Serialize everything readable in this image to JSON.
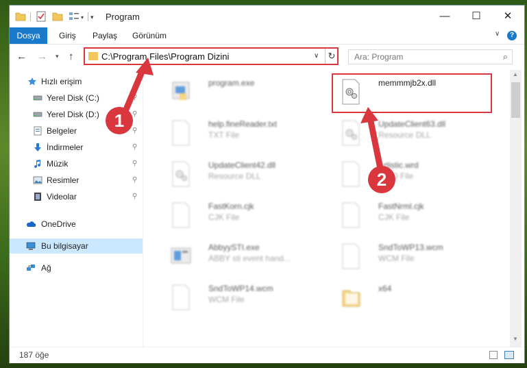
{
  "titlebar": {
    "title": "Program",
    "minimize": "—",
    "maximize": "☐",
    "close": "✕"
  },
  "ribbon": {
    "file_tab": "Dosya",
    "tabs": [
      "Giriş",
      "Paylaş",
      "Görünüm"
    ],
    "help": "?"
  },
  "nav": {
    "back": "←",
    "forward": "→",
    "recent": "▾",
    "up": "↑"
  },
  "address": {
    "path": "C:\\Program Files\\Program Dizini",
    "dropdown": "∨",
    "refresh": "↻"
  },
  "search": {
    "placeholder": "Ara: Program",
    "icon": "⌕"
  },
  "sidebar": {
    "pin": "📌",
    "items": [
      {
        "label": "Hızlı erişim",
        "icon": "star-icon",
        "pinned": false
      },
      {
        "label": "Yerel Disk (C:)",
        "icon": "drive-icon",
        "pinned": true
      },
      {
        "label": "Yerel Disk (D:)",
        "icon": "drive-icon",
        "pinned": true
      },
      {
        "label": "Belgeler",
        "icon": "documents-icon",
        "pinned": true
      },
      {
        "label": "İndirmeler",
        "icon": "download-icon",
        "pinned": true
      },
      {
        "label": "Müzik",
        "icon": "music-icon",
        "pinned": true
      },
      {
        "label": "Resimler",
        "icon": "pictures-icon",
        "pinned": true
      },
      {
        "label": "Videolar",
        "icon": "videos-icon",
        "pinned": true
      },
      {
        "label": "OneDrive",
        "icon": "onedrive-icon",
        "pinned": false
      },
      {
        "label": "Bu bilgisayar",
        "icon": "computer-icon",
        "pinned": false,
        "selected": true
      },
      {
        "label": "Ağ",
        "icon": "network-icon",
        "pinned": false
      }
    ]
  },
  "files": [
    {
      "name": "program.exe",
      "type": "",
      "icon": "exe-icon"
    },
    {
      "name": "memmmjb2x.dll",
      "type": "",
      "icon": "dll-gear-icon"
    },
    {
      "name": "help.fineReader.txt",
      "type": "TXT File",
      "icon": "document-icon"
    },
    {
      "name": "UpdateClient63.dll",
      "type": "Resource DLL",
      "icon": "dll-gear-icon"
    },
    {
      "name": "UpdateClient42.dll",
      "type": "Resource DLL",
      "icon": "dll-gear-icon"
    },
    {
      "name": "Artistic.wrd",
      "type": "WRD File",
      "icon": "document-icon"
    },
    {
      "name": "FastKorn.cjk",
      "type": "CJK File",
      "icon": "document-icon"
    },
    {
      "name": "FastNrml.cjk",
      "type": "CJK File",
      "icon": "document-icon"
    },
    {
      "name": "AbbyySTI.exe",
      "type": "ABBY sti event hand...",
      "icon": "exe-icon"
    },
    {
      "name": "SndToWP13.wcm",
      "type": "WCM File",
      "icon": "document-icon"
    },
    {
      "name": "SndToWP14.wcm",
      "type": "WCM File",
      "icon": "document-icon"
    },
    {
      "name": "x64",
      "type": "",
      "icon": "folder-icon"
    }
  ],
  "status": {
    "count": "187 öğe"
  },
  "callouts": [
    "1",
    "2"
  ],
  "colors": {
    "accent": "#1979ca",
    "highlight": "#d9363e",
    "selected": "#cce8ff"
  }
}
